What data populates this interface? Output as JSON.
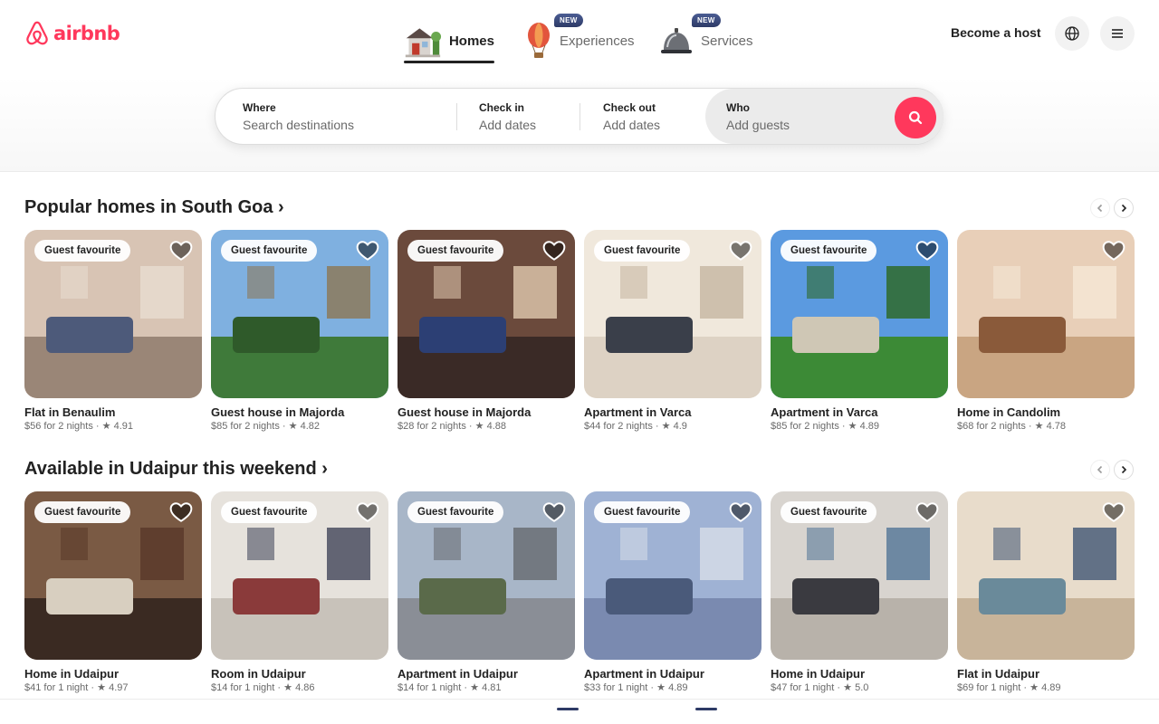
{
  "brand": {
    "name": "airbnb",
    "color": "#ff385c"
  },
  "nav": {
    "tabs": [
      {
        "label": "Homes",
        "icon": "house-icon",
        "active": true,
        "badge": ""
      },
      {
        "label": "Experiences",
        "icon": "hot-air-balloon-icon",
        "active": false,
        "badge": "NEW"
      },
      {
        "label": "Services",
        "icon": "service-bell-icon",
        "active": false,
        "badge": "NEW"
      }
    ],
    "become_host": "Become a host",
    "globe_icon": "globe-icon",
    "menu_icon": "hamburger-menu-icon"
  },
  "search": {
    "where_label": "Where",
    "where_placeholder": "Search destinations",
    "checkin_label": "Check in",
    "checkin_placeholder": "Add dates",
    "checkout_label": "Check out",
    "checkout_placeholder": "Add dates",
    "who_label": "Who",
    "who_placeholder": "Add guests",
    "button_icon": "search-icon"
  },
  "sections": [
    {
      "title": "Popular homes in South Goa",
      "listings": [
        {
          "badge": "Guest favourite",
          "title": "Flat in Benaulim",
          "price": "$56 for 2 nights",
          "rating": "4.91"
        },
        {
          "badge": "Guest favourite",
          "title": "Guest house in Majorda",
          "price": "$85 for 2 nights",
          "rating": "4.82"
        },
        {
          "badge": "Guest favourite",
          "title": "Guest house in Majorda",
          "price": "$28 for 2 nights",
          "rating": "4.88"
        },
        {
          "badge": "Guest favourite",
          "title": "Apartment in Varca",
          "price": "$44 for 2 nights",
          "rating": "4.9"
        },
        {
          "badge": "Guest favourite",
          "title": "Apartment in Varca",
          "price": "$85 for 2 nights",
          "rating": "4.89"
        },
        {
          "badge": "",
          "title": "Home in Candolim",
          "price": "$68 for 2 nights",
          "rating": "4.78"
        }
      ]
    },
    {
      "title": "Available in Udaipur this weekend",
      "listings": [
        {
          "badge": "Guest favourite",
          "title": "Home in Udaipur",
          "price": "$41 for 1 night",
          "rating": "4.97"
        },
        {
          "badge": "Guest favourite",
          "title": "Room in Udaipur",
          "price": "$14 for 1 night",
          "rating": "4.86"
        },
        {
          "badge": "Guest favourite",
          "title": "Apartment in Udaipur",
          "price": "$14 for 1 night",
          "rating": "4.81"
        },
        {
          "badge": "Guest favourite",
          "title": "Apartment in Udaipur",
          "price": "$33 for 1 night",
          "rating": "4.89"
        },
        {
          "badge": "Guest favourite",
          "title": "Home in Udaipur",
          "price": "$47 for 1 night",
          "rating": "5.0"
        },
        {
          "badge": "",
          "title": "Flat in Udaipur",
          "price": "$69 for 1 night",
          "rating": "4.89"
        }
      ]
    }
  ]
}
